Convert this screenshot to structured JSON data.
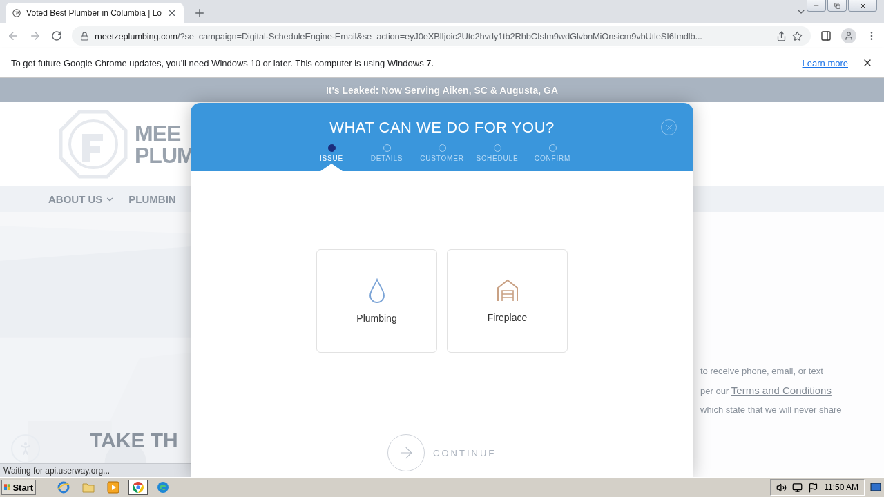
{
  "browser": {
    "tab": {
      "title": "Voted Best Plumber in Columbia | Lo"
    },
    "url": {
      "host": "meetzeplumbing.com",
      "path": "/?se_campaign=Digital-ScheduleEngine-Email&se_action=eyJ0eXBlIjoic2Utc2hvdy1tb2RhbCIsIm9wdGlvbnMiOnsicm9vbUtleSI6Imdlb..."
    },
    "infobar": {
      "message": "To get future Google Chrome updates, you'll need Windows 10 or later. This computer is using Windows 7.",
      "link": "Learn more"
    }
  },
  "site": {
    "banner": "It's Leaked: Now Serving Aiken, SC & Augusta, GA",
    "logo": [
      "MEE",
      "PLUM"
    ],
    "nav": [
      "ABOUT US",
      "PLUMBIN"
    ],
    "hero": "TAKE TH",
    "side_text": [
      {
        "text": "to receive phone, email, or text"
      },
      {
        "text": "per our",
        "link": "Terms and Conditions"
      },
      {
        "text": "which state that we will never share"
      }
    ]
  },
  "modal": {
    "title": "WHAT CAN WE DO FOR YOU?",
    "steps": [
      {
        "label": "ISSUE",
        "selected": true
      },
      {
        "label": "DETAILS",
        "selected": false
      },
      {
        "label": "CUSTOMER",
        "selected": false
      },
      {
        "label": "SCHEDULE",
        "selected": false
      },
      {
        "label": "CONFIRM",
        "selected": false
      }
    ],
    "options": [
      {
        "kind": "plumbing",
        "label": "Plumbing"
      },
      {
        "kind": "fireplace",
        "label": "Fireplace"
      }
    ],
    "continue": "CONTINUE"
  },
  "status": "Waiting for api.userway.org...",
  "taskbar": {
    "start": "Start",
    "apps": [
      {
        "kind": "ie",
        "selected": false
      },
      {
        "kind": "folder",
        "selected": false
      },
      {
        "kind": "media",
        "selected": false
      },
      {
        "kind": "chrome",
        "selected": true
      },
      {
        "kind": "edge",
        "selected": false
      }
    ],
    "clock": "11:50 AM"
  }
}
